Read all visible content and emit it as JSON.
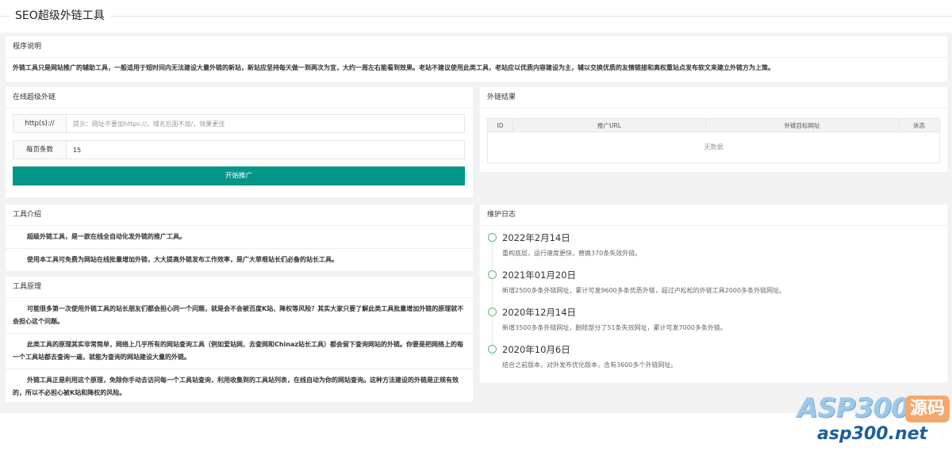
{
  "header": {
    "title": "SEO超级外链工具"
  },
  "desc": {
    "title": "程序说明",
    "text": "外链工具只是网站推广的辅助工具，一般适用于短时间内无法建设大量外链的新站，新站应坚持每天做一到两次为宜，大约一周左右能看到效果。老站不建议使用此类工具，老站应以优质内容建设为主，辅以交换优质的友情链接和高权重站点发布软文来建立外链方为上策。"
  },
  "online": {
    "title": "在线超级外链",
    "url_label": "http(s)://",
    "url_placeholder": "提示：网址不要加https://，域名后面不加/，效果更佳",
    "per_label": "每页条数",
    "per_value": "15",
    "submit_label": "开始推广"
  },
  "result": {
    "title": "外链结果",
    "columns": [
      "ID",
      "推广URL",
      "外链目标网址",
      "状态"
    ],
    "empty_text": "无数据"
  },
  "intro": {
    "title": "工具介绍",
    "paragraphs": [
      "超级外链工具，是一款在线全自动化发外链的推广工具。",
      "使用本工具可免费为网站在线批量增加外链，大大提高外链发布工作效率，是广大草根站长们必备的站长工具。"
    ]
  },
  "principle": {
    "title": "工具原理",
    "paragraphs": [
      "可能很多第一次使用外链工具的站长朋友们都会担心同一个问题，就是会不会被百度K站、降权等风险？其实大家只要了解此类工具批量增加外链的原理就不会担心这个问题。",
      "此类工具的原理其实非常简单，网络上几乎所有的网站查询工具（例如爱站网、去查网和Chinaz站长工具）都会留下查询网站的外链。你要是把网络上的每一个工具站都去查询一遍，就能为查询的网站建设大量的外链。",
      "外链工具正是利用这个原理，免除你手动去访问每一个工具站查询，利用收集到的工具站列表，在线自动为你的网站查询。这种方法建设的外链是正规有效的，所以不必担心被K站和降权的风险。"
    ]
  },
  "log": {
    "title": "维护日志",
    "items": [
      {
        "date": "2022年2月14日",
        "text": "重构底层，运行速度更快，替换370条失效外链。"
      },
      {
        "date": "2021年01月20日",
        "text": "新增2500多条外链网址，累计可发9600多条优质外链，超过卢松松的外链工具2000多条外链网址。"
      },
      {
        "date": "2020年12月14日",
        "text": "新增3500多条外链网址，删除部分了51条失效网址，累计可发7000多条外链。"
      },
      {
        "date": "2020年10月6日",
        "text": "结合之前版本，对外发布优化版本，含有3600多个外链网址。"
      }
    ]
  },
  "watermark": {
    "brand": "ASP300",
    "badge": "源码",
    "site": "asp300.net"
  },
  "colors": {
    "primary": "#009688",
    "timeline": "#5FB878",
    "background": "#f2f2f2"
  }
}
